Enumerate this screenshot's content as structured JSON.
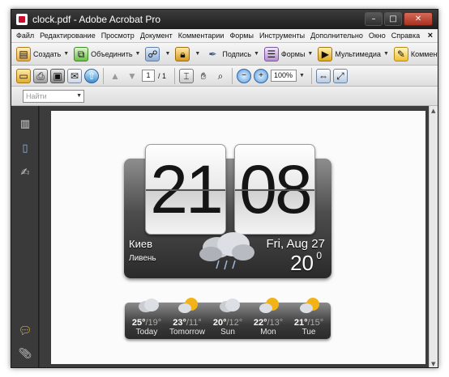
{
  "window": {
    "title": "clock.pdf - Adobe Acrobat Pro",
    "controls": {
      "minimize": "–",
      "maximize": "□",
      "close": "✕"
    }
  },
  "menubar": {
    "items": [
      "Файл",
      "Редактирование",
      "Просмотр",
      "Документ",
      "Комментарии",
      "Формы",
      "Инструменты",
      "Дополнительно",
      "Окно",
      "Справка"
    ],
    "close": "×"
  },
  "toolbar1": {
    "create": "Создать",
    "combine": "Объединить",
    "sign": "Подпись",
    "forms": "Формы",
    "multimedia": "Мультимедиа",
    "comment": "Комментарий"
  },
  "toolbar2": {
    "current_page": "1",
    "page_total": "/ 1",
    "zoom": "100%"
  },
  "toolbar3": {
    "search_placeholder": "Найти"
  },
  "clock": {
    "hours": "21",
    "minutes": "08",
    "city": "Киев",
    "condition": "Ливень",
    "date": "Fri, Aug 27",
    "temperature": "20",
    "degree": "0"
  },
  "forecast": [
    {
      "high": "25°",
      "low": "/19°",
      "day": "Today",
      "icon": "cloud-icon"
    },
    {
      "high": "23°",
      "low": "/11°",
      "day": "Tomorrow",
      "icon": "sun-cloud-icon"
    },
    {
      "high": "20°",
      "low": "/12°",
      "day": "Sun",
      "icon": "cloud-icon"
    },
    {
      "high": "22°",
      "low": "/13°",
      "day": "Mon",
      "icon": "sun-cloud-icon"
    },
    {
      "high": "21°",
      "low": "/15°",
      "day": "Tue",
      "icon": "sun-cloud-icon"
    }
  ],
  "colors": {
    "chrome_dark": "#2d2d2d",
    "toolbar_light": "#e8e8e8",
    "page": "#fbfbfb",
    "sun": "#f2b319"
  }
}
